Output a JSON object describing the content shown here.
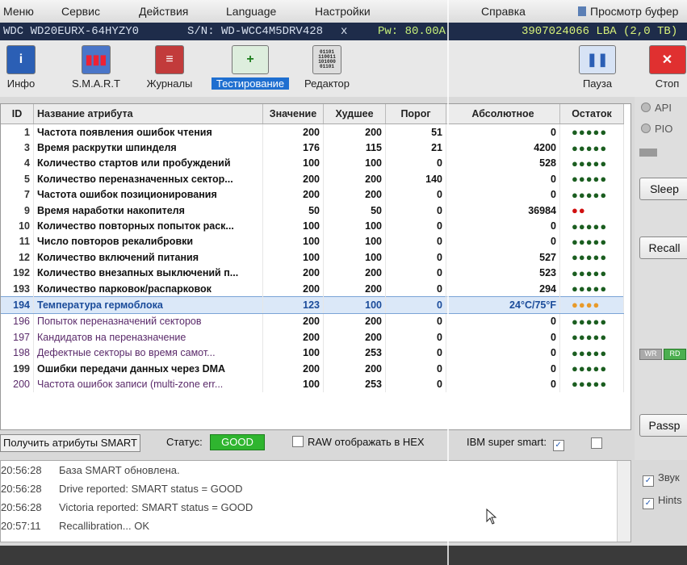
{
  "menu": {
    "items": [
      "Меню",
      "Сервис",
      "Действия",
      "Language",
      "Настройки",
      "Справка",
      "Просмотр буфер"
    ]
  },
  "device": {
    "model": "WDC WD20EURX-64HYZY0",
    "serial": "S/N: WD-WCC4M5DRV428",
    "close": "x",
    "power": "Pw: 80.00A",
    "lba": "3907024066 LBA (2,0 TB)"
  },
  "toolbar": {
    "info": "Инфо",
    "smart": "S.M.A.R.T",
    "logs": "Журналы",
    "test": "Тестирование",
    "editor": "Редактор",
    "pause": "Пауза",
    "stop": "Стоп",
    "editor_icon_text": "01101\n110011\n101000\n01101",
    "icons": [
      "info-icon",
      "chart-icon",
      "journal-icon",
      "test-plus-icon",
      "binary-editor-icon",
      "pause-icon",
      "stop-icon"
    ]
  },
  "table": {
    "headers": [
      "ID",
      "Название атрибута",
      "Значение",
      "Худшее",
      "Порог",
      "Абсолютное",
      "Остаток"
    ],
    "rows": [
      {
        "id": "1",
        "name": "Частота появления ошибок чтения",
        "value": "200",
        "worst": "200",
        "thresh": "51",
        "raw": "0",
        "rem": "●●●●●",
        "color": "green"
      },
      {
        "id": "3",
        "name": "Время раскрутки шпинделя",
        "value": "176",
        "worst": "115",
        "thresh": "21",
        "raw": "4200",
        "rem": "●●●●●",
        "color": "green"
      },
      {
        "id": "4",
        "name": "Количество стартов или пробуждений",
        "value": "100",
        "worst": "100",
        "thresh": "0",
        "raw": "528",
        "rem": "●●●●●",
        "color": "green"
      },
      {
        "id": "5",
        "name": "Количество переназначенных сектор...",
        "value": "200",
        "worst": "200",
        "thresh": "140",
        "raw": "0",
        "rem": "●●●●●",
        "color": "green"
      },
      {
        "id": "7",
        "name": "Частота ошибок позиционирования",
        "value": "200",
        "worst": "200",
        "thresh": "0",
        "raw": "0",
        "rem": "●●●●●",
        "color": "green"
      },
      {
        "id": "9",
        "name": "Время наработки накопителя",
        "value": "50",
        "worst": "50",
        "thresh": "0",
        "raw": "36984",
        "rem": "●●",
        "color": "red"
      },
      {
        "id": "10",
        "name": "Количество повторных попыток раск...",
        "value": "100",
        "worst": "100",
        "thresh": "0",
        "raw": "0",
        "rem": "●●●●●",
        "color": "green"
      },
      {
        "id": "11",
        "name": "Число повторов рекалибровки",
        "value": "100",
        "worst": "100",
        "thresh": "0",
        "raw": "0",
        "rem": "●●●●●",
        "color": "green"
      },
      {
        "id": "12",
        "name": "Количество включений питания",
        "value": "100",
        "worst": "100",
        "thresh": "0",
        "raw": "527",
        "rem": "●●●●●",
        "color": "green"
      },
      {
        "id": "192",
        "name": "Количество внезапных выключений п...",
        "value": "200",
        "worst": "200",
        "thresh": "0",
        "raw": "523",
        "rem": "●●●●●",
        "color": "green"
      },
      {
        "id": "193",
        "name": "Количество парковок/распарковок",
        "value": "200",
        "worst": "200",
        "thresh": "0",
        "raw": "294",
        "rem": "●●●●●",
        "color": "green"
      },
      {
        "id": "194",
        "name": "Температура гермоблока",
        "value": "123",
        "worst": "100",
        "thresh": "0",
        "raw": "24°C/75°F",
        "rem": "●●●●",
        "color": "orange",
        "highlight": true
      },
      {
        "id": "196",
        "name": "Попыток переназначений секторов",
        "value": "200",
        "worst": "200",
        "thresh": "0",
        "raw": "0",
        "rem": "●●●●●",
        "color": "green",
        "critical": true
      },
      {
        "id": "197",
        "name": "Кандидатов на переназначение",
        "value": "200",
        "worst": "200",
        "thresh": "0",
        "raw": "0",
        "rem": "●●●●●",
        "color": "green",
        "critical": true
      },
      {
        "id": "198",
        "name": "Дефектные секторы во время самот...",
        "value": "100",
        "worst": "253",
        "thresh": "0",
        "raw": "0",
        "rem": "●●●●●",
        "color": "green",
        "critical": true
      },
      {
        "id": "199",
        "name": "Ошибки передачи данных через DMA",
        "value": "200",
        "worst": "200",
        "thresh": "0",
        "raw": "0",
        "rem": "●●●●●",
        "color": "green"
      },
      {
        "id": "200",
        "name": "Частота ошибок записи (multi-zone err...",
        "value": "100",
        "worst": "253",
        "thresh": "0",
        "raw": "0",
        "rem": "●●●●●",
        "color": "green",
        "critical": true
      }
    ]
  },
  "side": {
    "api": "API",
    "pio": "PIO",
    "sleep": "Sleep",
    "recall": "Recall",
    "passp": "Passp",
    "wr": "WR",
    "rd": "RD"
  },
  "status": {
    "get_smart": "Получить атрибуты SMART",
    "label": "Статус:",
    "value": "GOOD",
    "raw_hex": "RAW отображать в HEX",
    "ibm": "IBM super smart:"
  },
  "log": [
    {
      "time": "20:56:28",
      "msg": "База SMART обновлена."
    },
    {
      "time": "20:56:28",
      "msg": "Drive reported: SMART status = GOOD"
    },
    {
      "time": "20:56:28",
      "msg": "Victoria reported: SMART status = GOOD"
    },
    {
      "time": "20:57:11",
      "msg": "Recallibration... OK"
    }
  ],
  "options": {
    "sound": "Звук",
    "hints": "Hints"
  },
  "colors": {
    "good": "#2fb52f",
    "info_bar": "#1e2c4a",
    "selection": "#1f6fd0",
    "dot_green": "#1b5e20",
    "dot_red": "#d01010",
    "dot_orange": "#e89a2a"
  }
}
